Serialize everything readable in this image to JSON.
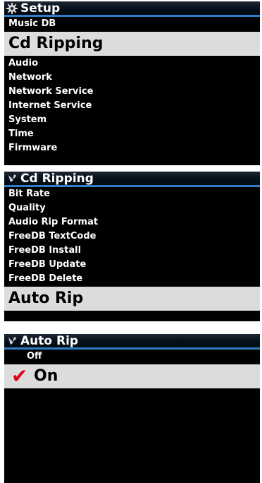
{
  "screens": [
    {
      "title": "Setup",
      "icon": "gear-icon",
      "items": [
        "Music DB",
        "Cd Ripping",
        "Audio",
        "Network",
        "Network Service",
        "Internet Service",
        "System",
        "Time",
        "Firmware"
      ],
      "selected": "Cd Ripping"
    },
    {
      "title": "Cd Ripping",
      "icon": "satellite-icon",
      "items": [
        "Bit Rate",
        "Quality",
        "Audio Rip Format",
        "FreeDB TextCode",
        "FreeDB Install",
        "FreeDB Update",
        "FreeDB Delete",
        "Auto Rip"
      ],
      "selected": "Auto Rip"
    },
    {
      "title": "Auto Rip",
      "icon": "satellite-icon",
      "items": [
        "Off",
        "On"
      ],
      "selected": "On",
      "checked_mark": "✔"
    }
  ],
  "colors": {
    "title_bar_accent": "#2f7fc8",
    "selection_bg": "#dcdcdc",
    "check_red": "#e0001a"
  }
}
